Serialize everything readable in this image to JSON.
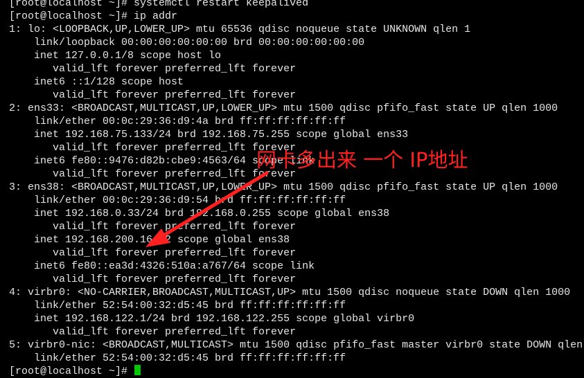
{
  "terminal": {
    "background": "#000000",
    "foreground": "#e6e6e6",
    "cursor_color": "#00c800",
    "lines": [
      "[root@localhost ~]# systemctl restart keepalived",
      "[root@localhost ~]# ip addr",
      "1: lo: <LOOPBACK,UP,LOWER_UP> mtu 65536 qdisc noqueue state UNKNOWN qlen 1",
      "    link/loopback 00:00:00:00:00:00 brd 00:00:00:00:00:00",
      "    inet 127.0.0.1/8 scope host lo",
      "       valid_lft forever preferred_lft forever",
      "    inet6 ::1/128 scope host",
      "       valid_lft forever preferred_lft forever",
      "2: ens33: <BROADCAST,MULTICAST,UP,LOWER_UP> mtu 1500 qdisc pfifo_fast state UP qlen 1000",
      "    link/ether 00:0c:29:36:d9:4a brd ff:ff:ff:ff:ff:ff",
      "    inet 192.168.75.133/24 brd 192.168.75.255 scope global ens33",
      "       valid_lft forever preferred_lft forever",
      "    inet6 fe80::9476:d82b:cbe9:4563/64 scope link",
      "       valid_lft forever preferred_lft forever",
      "3: ens38: <BROADCAST,MULTICAST,UP,LOWER_UP> mtu 1500 qdisc pfifo_fast state UP qlen 1000",
      "    link/ether 00:0c:29:36:d9:54 brd ff:ff:ff:ff:ff:ff",
      "    inet 192.168.0.33/24 brd 192.168.0.255 scope global ens38",
      "       valid_lft forever preferred_lft forever",
      "    inet 192.168.200.16/32 scope global ens38",
      "       valid_lft forever preferred_lft forever",
      "    inet6 fe80::ea3d:4326:510a:a767/64 scope link",
      "       valid_lft forever preferred_lft forever",
      "4: virbr0: <NO-CARRIER,BROADCAST,MULTICAST,UP> mtu 1500 qdisc noqueue state DOWN qlen 1000",
      "    link/ether 52:54:00:32:d5:45 brd ff:ff:ff:ff:ff:ff",
      "    inet 192.168.122.1/24 brd 192.168.122.255 scope global virbr0",
      "       valid_lft forever preferred_lft forever",
      "5: virbr0-nic: <BROADCAST,MULTICAST> mtu 1500 qdisc pfifo_fast master virbr0 state DOWN qlen 1000",
      "    link/ether 52:54:00:32:d5:45 brd ff:ff:ff:ff:ff:ff",
      "[root@localhost ~]# "
    ]
  },
  "annotation": {
    "text": "网卡多出来 一个 IP地址",
    "color": "#ff2020"
  }
}
